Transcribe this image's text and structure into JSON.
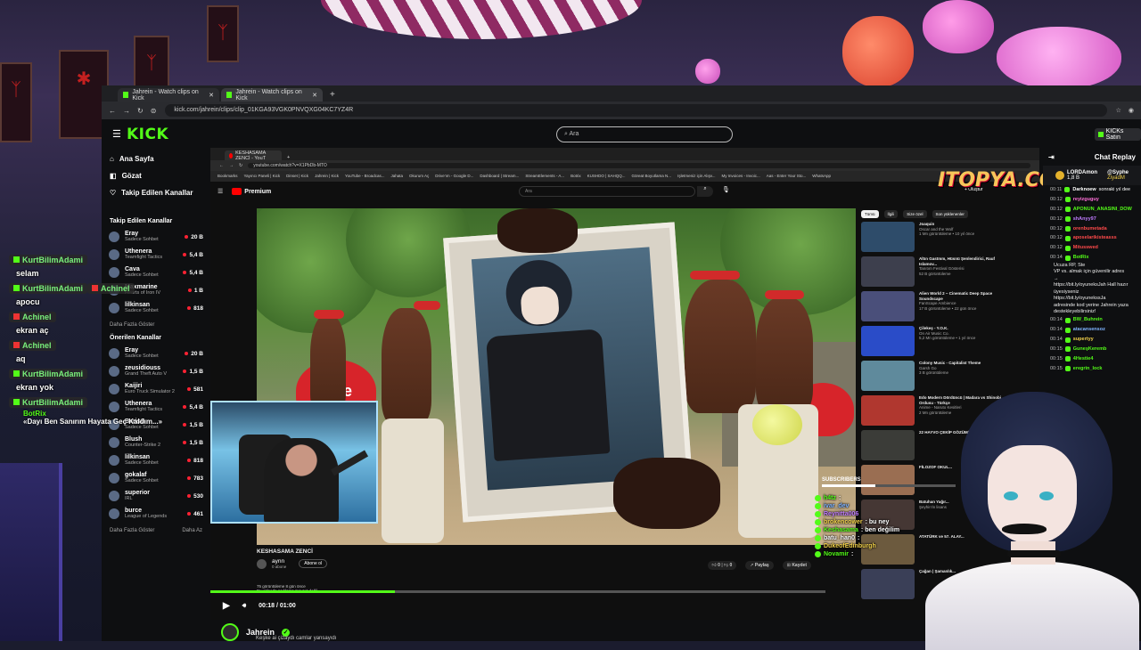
{
  "browser": {
    "tabs": [
      "Jahrein - Watch clips on Kick",
      "Jahrein - Watch clips on Kick"
    ],
    "url": "kick.com/jahrein/clips/clip_01KGA93VGK0PNVQXG04KC7YZ4R"
  },
  "kick": {
    "logo": "KICK",
    "search_placeholder": "Ara",
    "right_button": "KICKs Satın",
    "nav": [
      "Ana Sayfa",
      "Gözat",
      "Takip Edilen Kanallar"
    ],
    "followed_heading": "Takip Edilen Kanallar",
    "followed": [
      {
        "name": "Eray",
        "category": "Sadece Sohbet",
        "viewers": "20 B",
        "live": true
      },
      {
        "name": "Uthenera",
        "category": "Teamfight Tactics",
        "viewers": "5,4 B",
        "live": true
      },
      {
        "name": "Cava",
        "category": "Sadece Sohbet",
        "viewers": "5,4 B",
        "live": true
      },
      {
        "name": "Maxmarine",
        "category": "Hearts of Iron IV",
        "viewers": "1 B",
        "live": true
      },
      {
        "name": "lilkinsan",
        "category": "Sadece Sohbet",
        "viewers": "818",
        "live": true
      }
    ],
    "followed_more": "Daha Fazla Göster",
    "recommended_heading": "Önerilen Kanallar",
    "recommended": [
      {
        "name": "Eray",
        "category": "Sadece Sohbet",
        "viewers": "20 B"
      },
      {
        "name": "zeusidiouss",
        "category": "Grand Theft Auto V",
        "viewers": "1,5 B"
      },
      {
        "name": "Kaijiri",
        "category": "Euro Truck Simulator 2",
        "viewers": "581"
      },
      {
        "name": "Uthenera",
        "category": "Teamfight Tactics",
        "viewers": "5,4 B"
      },
      {
        "name": "BarisG",
        "category": "Sadece Sohbet",
        "viewers": "1,5 B"
      },
      {
        "name": "Blush",
        "category": "Counter-Strike 2",
        "viewers": "1,5 B"
      },
      {
        "name": "lilkinsan",
        "category": "Sadece Sohbet",
        "viewers": "818"
      },
      {
        "name": "gokalaf",
        "category": "Sadece Sohbet",
        "viewers": "783"
      },
      {
        "name": "superior",
        "category": "IRL",
        "viewers": "530"
      },
      {
        "name": "burce",
        "category": "League of Legends",
        "viewers": "461"
      }
    ],
    "recommended_more": "Daha Fazla Göster",
    "recommended_more_right": "Daha Az",
    "channel_name": "Jahrein",
    "channel_sub": "Keşke ai çizaydı camlar yansayıdı"
  },
  "youtube": {
    "tab": "KESHASAMA ZENCİ - YouT",
    "url": "youtube.com/watch?v=X1PbDb-MTO",
    "bookmarks": [
      "Bookmarks",
      "Yayıncı Paneli | Kick",
      "Dinset | Kick",
      "Jahrein | Kick",
      "YouTube - Broadcas...",
      "Jahata",
      "Okurum Aç",
      "Drive'ım - Google D...",
      "Dashboard | Stream...",
      "StreamElements - A...",
      "Botrix",
      "KUSHDO | SAHQQ...",
      "Göreat Boyutlama N...",
      "Işletmeniz için Alışv...",
      "My Invoices - Invoic...",
      "Aas - Enter Your Sto...",
      "WhatsApp"
    ],
    "logo": "Premium",
    "search_placeholder": "Ara",
    "create": "+ Oluştur",
    "video_title": "KESHASAMA ZENCİ",
    "channel": "aynn",
    "channel_subs": "0 abone",
    "subscribe": "Abone ol",
    "likes": "0",
    "dislikes": "0",
    "share": "Paylaş",
    "save": "Kaydet",
    "views": "75 görüntüleme  8 gün önce",
    "desc": "Bu videoda açıklama mevcut değil",
    "chips": [
      "Tümü",
      "İlgili",
      "Size özel",
      "Son yüklenenler"
    ],
    "recommendations": [
      {
        "title": "Joaquin",
        "channel": "Oscar and the Wolf",
        "meta": "1 Mn görüntüleme • 10 yıl önce",
        "color": "#2e4c6a"
      },
      {
        "title": "Altın Gastmm, Hüsnü Şenlendirici, Rauf Islamov...",
        "channel": "Tanıtım Festival Gösterisi",
        "meta": "52 B görüntüleme",
        "color": "#3d3f4d"
      },
      {
        "title": "Alien World 2 ~ Cinematic Deep Space Soundscape",
        "channel": "FanScape Ambience",
        "meta": "17 B görüntüleme • 22 gün önce",
        "color": "#4a4f7a"
      },
      {
        "title": "Çilekeş - Y.O.K.",
        "channel": "On Air Music Co.",
        "meta": "5,2 Mn görüntüleme • 1 yıl önce",
        "color": "#2a4cc8"
      },
      {
        "title": "Colony Music - Capitalist Theme",
        "channel": "Garsh Go",
        "meta": "3 B görüntüleme",
        "color": "#5f8a9c"
      },
      {
        "title": "Edo Modern Dördüncü | Madara vs Shinobi Ordusu - Türkçe",
        "channel": "Anime - Naruto Kesitleri",
        "meta": "2 Mn görüntüleme",
        "color": "#b0372f"
      },
      {
        "title": "22 HAYVO ÇEKİP GÖZÜMÜ DAĞLADI...",
        "channel": "",
        "meta": "",
        "color": "#3b3c38"
      },
      {
        "title": "FİLOZOF OKUL...",
        "channel": "",
        "meta": "",
        "color": "#9a6e52"
      },
      {
        "title": "Batuhan Yağır...",
        "channel": "Şeyhin'in lisans",
        "meta": "",
        "color": "#453734"
      },
      {
        "title": "ATATÜRK ve 57. ALAY...",
        "channel": "",
        "meta": "",
        "color": "#6c5a3e"
      },
      {
        "title": "Çağan | Şamanlık...",
        "channel": "",
        "meta": "",
        "color": "#3a3f57"
      }
    ]
  },
  "player": {
    "time": "00:18 / 01:00",
    "progress": 0.3
  },
  "chat_panel": {
    "title": "Chat Replay",
    "pinned": {
      "user": "LORDAmon",
      "amount": "1,8 B",
      "target": "@Syphe",
      "second": "ZiyadM"
    },
    "messages": [
      {
        "time": "00:11",
        "user": "Darknoew",
        "color": "#ffffff",
        "text": "sonraki yıl dee"
      },
      {
        "time": "00:12",
        "user": "reyizguguy",
        "color": "#ff6fd8",
        "text": ""
      },
      {
        "time": "00:12",
        "user": "APONUN_ANASINI_DOW",
        "color": "#53fc18",
        "text": ""
      },
      {
        "time": "00:12",
        "user": "shAnyy97",
        "color": "#c07cff",
        "text": ""
      },
      {
        "time": "00:12",
        "user": "orenbumetada",
        "color": "#ff4a4a",
        "text": ""
      },
      {
        "time": "00:12",
        "user": "aposelarikisteasss",
        "color": "#ff4a4a",
        "text": ""
      },
      {
        "time": "00:12",
        "user": "Mitusswed",
        "color": "#ff4a4a",
        "text": ""
      }
    ],
    "botrix_time": "00:14",
    "botrix_user": "BotRix",
    "botrix_lines": [
      "Ucuza RP, Ste",
      "VP vs. almak için güvenilir adres →",
      "https://bit.ly/oyuneksJah Hall hazır",
      "üyesiyseniz https://bit.ly/oyunekssJa",
      "adresinde kod yerine Jahrein yaza",
      "destekleyebilirsiniz!"
    ],
    "messages2": [
      {
        "time": "00:14",
        "user": "BW_Buhrein",
        "color": "#53fc18"
      },
      {
        "time": "00:14",
        "user": "atacansensoz",
        "color": "#7fb4ff"
      },
      {
        "time": "00:14",
        "user": "supertyy",
        "color": "#f3d24a"
      },
      {
        "time": "00:15",
        "user": "GuneşKeremb",
        "color": "#53fc18"
      },
      {
        "time": "00:15",
        "user": "4Hestie4",
        "color": "#53fc18"
      },
      {
        "time": "00:15",
        "user": "eregrin_lock",
        "color": "#53fc18"
      }
    ]
  },
  "stream_overlay": {
    "chat": [
      {
        "user": "KurtBilimAdami",
        "msg": "selam",
        "badge": "green"
      },
      {
        "user": "KurtBilimAdami",
        "msg": "",
        "badge": "green"
      },
      {
        "user": "Achinel",
        "msg": "apocu",
        "badge": "red"
      },
      {
        "user": "Achinel",
        "msg": "ekran aç",
        "badge": "red"
      },
      {
        "user": "Achinel",
        "msg": "aq",
        "badge": "red"
      },
      {
        "user": "KurtBilimAdami",
        "msg": "ekran yok",
        "badge": "green"
      },
      {
        "user": "KurtBilimAdami",
        "msg": "",
        "badge": "green"
      }
    ],
    "botrix_user": "BotRix",
    "botrix_msg": "«Dayı Ben Sanırım Hayata Geç Kaldım...»",
    "subs_label": "SUBSCRIBERS",
    "right_chat": [
      {
        "user": "h4tz",
        "msg": ":"
      },
      {
        "user": "ivar_dev",
        "msg": ""
      },
      {
        "user": "Reynitta006",
        "msg": ""
      },
      {
        "user": "brokencower",
        "msg": ": bu ney"
      },
      {
        "user": "Keshasama",
        "msg": ": ben değilim"
      },
      {
        "user": "batu_han0",
        "msg": ":"
      },
      {
        "user": "DukeofEdinburgh",
        "msg": ""
      },
      {
        "user": "Novamir",
        "msg": ":"
      }
    ],
    "watermark": "ITOPYA.COM"
  },
  "colors": {
    "kick_green": "#53fc18",
    "bg": "#0e0f11"
  }
}
